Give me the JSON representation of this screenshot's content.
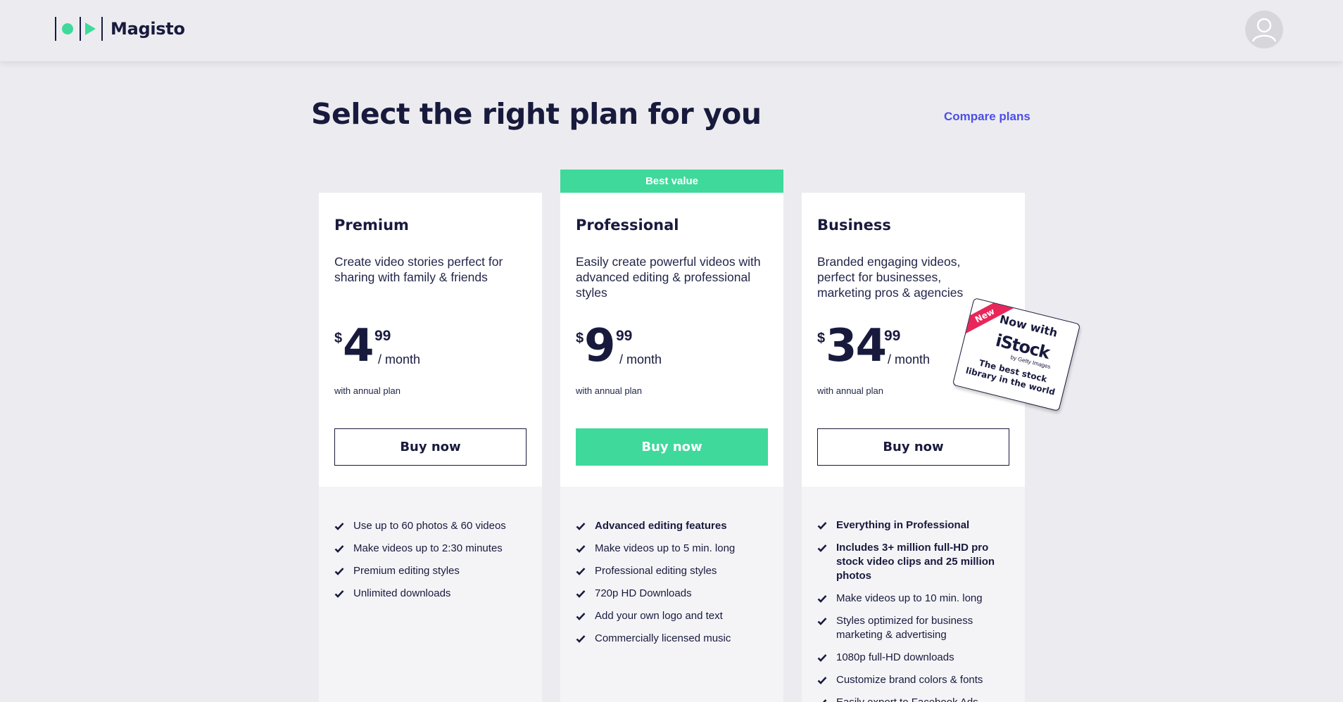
{
  "header": {
    "brand": "Magisto",
    "colors": {
      "accent": "#3fd99b",
      "text": "#181a3d",
      "link": "#4c4ee6",
      "badge": "#e8265a"
    }
  },
  "main": {
    "title": "Select the right plan for you",
    "compare_link": "Compare plans",
    "best_value_label": "Best value"
  },
  "plans": [
    {
      "name": "Premium",
      "description": "Create video stories perfect for sharing with family & friends",
      "currency": "$",
      "price_int": "4",
      "price_cents": "99",
      "period": "/ month",
      "billing_note": "with annual plan",
      "button": "Buy now",
      "features": [
        {
          "text": "Use up to 60 photos & 60 videos",
          "bold": false
        },
        {
          "text": "Make videos up to 2:30 minutes",
          "bold": false
        },
        {
          "text": "Premium editing styles",
          "bold": false
        },
        {
          "text": "Unlimited downloads",
          "bold": false
        }
      ]
    },
    {
      "name": "Professional",
      "description": "Easily create powerful videos with advanced editing & professional styles",
      "currency": "$",
      "price_int": "9",
      "price_cents": "99",
      "period": "/ month",
      "billing_note": "with annual plan",
      "button": "Buy now",
      "features": [
        {
          "text": "Advanced editing features",
          "bold": true
        },
        {
          "text": "Make videos up to 5 min. long",
          "bold": false
        },
        {
          "text": "Professional editing styles",
          "bold": false
        },
        {
          "text": "720p HD Downloads",
          "bold": false
        },
        {
          "text": "Add your own logo and text",
          "bold": false
        },
        {
          "text": "Commercially licensed music",
          "bold": false
        }
      ]
    },
    {
      "name": "Business",
      "description": "Branded engaging videos, perfect for businesses, marketing pros & agencies",
      "currency": "$",
      "price_int": "34",
      "price_cents": "99",
      "period": "/ month",
      "billing_note": "with annual plan",
      "button": "Buy now",
      "features": [
        {
          "text": "Everything in Professional",
          "bold": true
        },
        {
          "text": "Includes 3+ million full-HD pro stock video clips and 25 million photos",
          "bold": true
        },
        {
          "text": "Make videos up to 10 min. long",
          "bold": false
        },
        {
          "text": "Styles optimized for business marketing & advertising",
          "bold": false
        },
        {
          "text": "1080p full-HD downloads",
          "bold": false
        },
        {
          "text": "Customize brand colors & fonts",
          "bold": false
        },
        {
          "text": "Easily export to Facebook Ads Manager",
          "bold": false
        }
      ]
    }
  ],
  "sticker": {
    "ribbon": "New",
    "line1": "Now with",
    "brand": "iStock",
    "sub": "by Getty Images",
    "tagline": "The best stock library in the world"
  }
}
